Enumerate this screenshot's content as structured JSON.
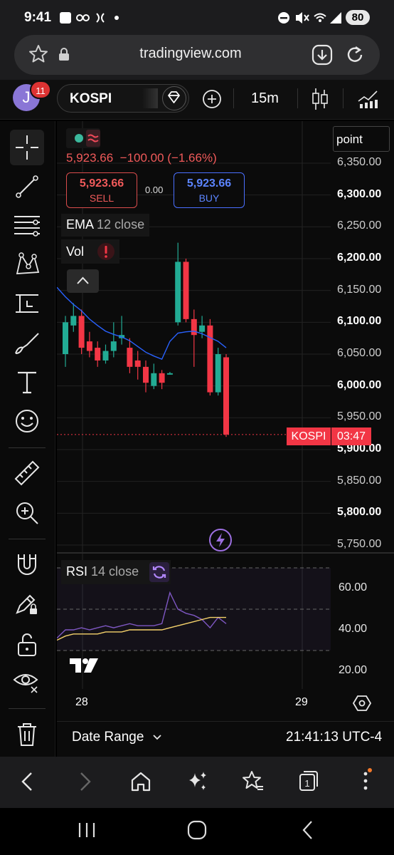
{
  "status_bar": {
    "time": "9:41",
    "battery": "80"
  },
  "browser": {
    "url": "tradingview.com"
  },
  "toolbar": {
    "notifications": "11",
    "avatar_letter": "J",
    "symbol": "KOSPI",
    "interval": "15m"
  },
  "chart": {
    "point_label": "point",
    "last_price": "5,923.66",
    "change": "−100.00 (−1.66%)",
    "sell_price": "5,923.66",
    "sell_label": "SELL",
    "buy_price": "5,923.66",
    "buy_label": "BUY",
    "spread": "0.00",
    "ema_name": "EMA",
    "ema_params": "12 close",
    "vol_label": "Vol",
    "price_axis": [
      "6,350.00",
      "6,300.00",
      "6,250.00",
      "6,200.00",
      "6,150.00",
      "6,100.00",
      "6,050.00",
      "6,000.00",
      "5,950.00",
      "5,900.00",
      "5,850.00",
      "5,800.00",
      "5,750.00"
    ],
    "price_tag_symbol": "KOSPI",
    "price_tag_timer": "03:47",
    "rsi_name": "RSI",
    "rsi_params": "14 close",
    "rsi_axis": [
      "60.00",
      "40.00",
      "20.00"
    ],
    "x_axis": [
      "28",
      "29"
    ],
    "date_range": "Date Range",
    "clock": "21:41:13 UTC-4"
  },
  "chart_data": {
    "type": "candlestick",
    "symbol": "KOSPI",
    "interval": "15m",
    "y_range": [
      5750,
      6350
    ],
    "candles": [
      {
        "o": 6050,
        "c": 6100,
        "h": 6110,
        "l": 6030
      },
      {
        "o": 6095,
        "c": 6110,
        "h": 6130,
        "l": 6085
      },
      {
        "o": 6110,
        "c": 6060,
        "h": 6120,
        "l": 6050
      },
      {
        "o": 6070,
        "c": 6055,
        "h": 6085,
        "l": 6045
      },
      {
        "o": 6060,
        "c": 6040,
        "h": 6070,
        "l": 6030
      },
      {
        "o": 6040,
        "c": 6055,
        "h": 6065,
        "l": 6035
      },
      {
        "o": 6055,
        "c": 6070,
        "h": 6100,
        "l": 6045
      },
      {
        "o": 6075,
        "c": 6080,
        "h": 6110,
        "l": 6065
      },
      {
        "o": 6060,
        "c": 6030,
        "h": 6075,
        "l": 6020
      },
      {
        "o": 6040,
        "c": 6030,
        "h": 6055,
        "l": 6010
      },
      {
        "o": 6030,
        "c": 6005,
        "h": 6040,
        "l": 5990
      },
      {
        "o": 6000,
        "c": 6020,
        "h": 6035,
        "l": 5995
      },
      {
        "o": 6020,
        "c": 6005,
        "h": 6025,
        "l": 5995
      },
      {
        "o": 6020,
        "c": 6020,
        "h": 6022,
        "l": 6018
      },
      {
        "o": 6100,
        "c": 6195,
        "h": 6225,
        "l": 6095
      },
      {
        "o": 6195,
        "c": 6105,
        "h": 6200,
        "l": 6100
      },
      {
        "o": 6105,
        "c": 6080,
        "h": 6120,
        "l": 6030
      },
      {
        "o": 6085,
        "c": 6095,
        "h": 6110,
        "l": 6075
      },
      {
        "o": 6095,
        "c": 5990,
        "h": 6105,
        "l": 5985
      },
      {
        "o": 5990,
        "c": 6050,
        "h": 6060,
        "l": 5985
      },
      {
        "o": 6045,
        "c": 5923.66,
        "h": 6050,
        "l": 5920
      }
    ],
    "ema12_close": [
      6140,
      6128,
      6118,
      6105,
      6095,
      6086,
      6081,
      6077,
      6071,
      6062,
      6053,
      6047,
      6042,
      6070,
      6083,
      6085,
      6086,
      6082,
      6076,
      6070,
      6060
    ],
    "rsi14": [
      40,
      40,
      41,
      40,
      41,
      42,
      41,
      42,
      43,
      42,
      42,
      42,
      43,
      58,
      50,
      48,
      47,
      45,
      41,
      46,
      43
    ],
    "rsi_ma": [
      37,
      38,
      38,
      38,
      38,
      39,
      39,
      39,
      40,
      40,
      40,
      40,
      40,
      41,
      42,
      43,
      44,
      45,
      46,
      46,
      46
    ],
    "rsi_levels": [
      70,
      50,
      30
    ],
    "rsi_range": [
      15,
      75
    ],
    "colors": {
      "up": "#22ab94",
      "down": "#f23645",
      "ema": "#2962ff",
      "rsi": "#7e57c2",
      "rsi_ma": "#f5d26b"
    }
  }
}
